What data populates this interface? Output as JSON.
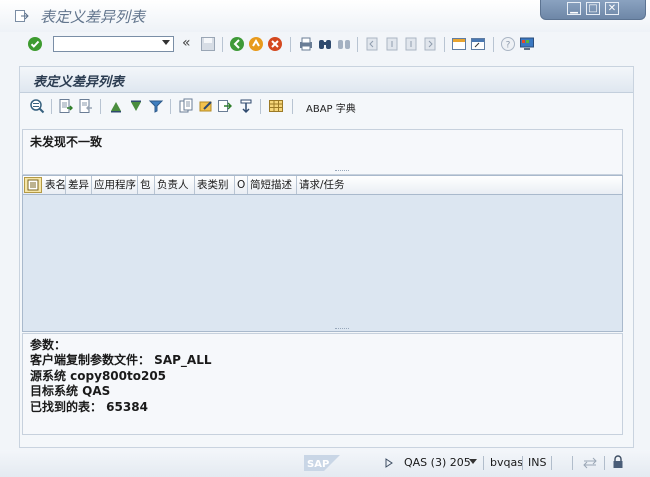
{
  "window": {
    "title": "表定义差异列表",
    "controls": [
      "minimize-icon",
      "maximize-icon",
      "close-icon"
    ]
  },
  "standard_toolbar": {
    "command_field": {
      "value": "",
      "placeholder": ""
    },
    "icons": [
      "enter-icon",
      "back-double-icon",
      "save-icon",
      "back-icon",
      "exit-icon",
      "cancel-icon",
      "print-icon",
      "find-icon",
      "find-next-icon",
      "first-page-icon",
      "previous-page-icon",
      "next-page-icon",
      "last-page-icon",
      "new-session-icon",
      "shortcut-icon",
      "help-icon",
      "layout-icon"
    ],
    "collapse_glyph": "«"
  },
  "panel": {
    "title": "表定义差异列表",
    "toolbar": {
      "icons": [
        "details-icon",
        "export-icon",
        "import-icon",
        "sort-ascending-icon",
        "sort-descending-icon",
        "filter-icon",
        "copy-icon",
        "change-icon",
        "compare-icon",
        "print-list-icon",
        "table-icon"
      ],
      "abap_dictionary_label": "ABAP 字典"
    }
  },
  "message": {
    "text": "未发现不一致"
  },
  "grid": {
    "columns": [
      "表名",
      "差异",
      "应用程序",
      "包",
      "负责人",
      "表类别",
      "O",
      "简短描述",
      "请求/任务"
    ],
    "rows": []
  },
  "info": {
    "lines": [
      "参数：",
      "客户端复制参数文件：  SAP_ALL",
      "源系统 copy800to205",
      "目标系统 QAS",
      "已找到的表：  65384"
    ]
  },
  "statusbar": {
    "logo": "SAP",
    "system": "QAS (3) 205",
    "server": "bvqas",
    "mode": "INS"
  },
  "colors": {
    "title": "#62758d",
    "panel_header": "#dfe7f0",
    "grid_background": "#dce6f1",
    "window_controls": "#7f97b6"
  }
}
